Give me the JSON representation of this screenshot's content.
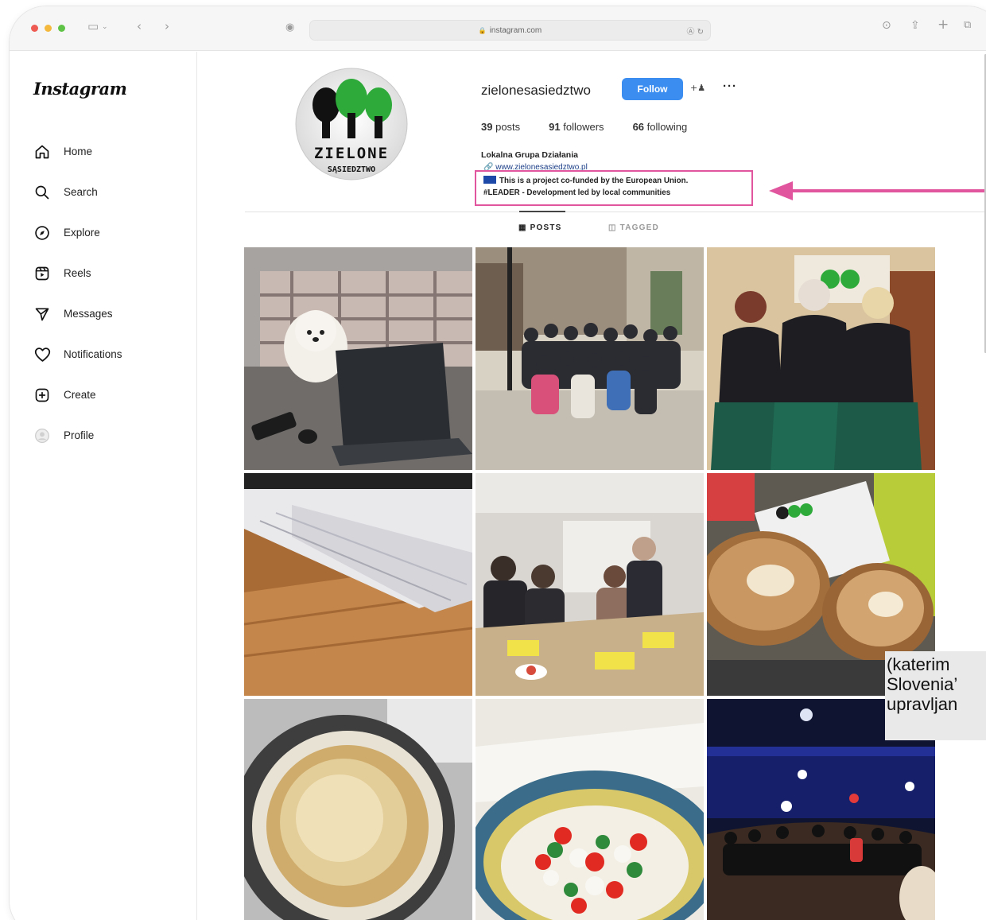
{
  "browser": {
    "url": "instagram.com",
    "url_right": "Ⓐ ↻"
  },
  "sidebar": {
    "logo": "Instagram",
    "items": [
      {
        "label": "Home",
        "icon": "home-icon"
      },
      {
        "label": "Search",
        "icon": "search-icon"
      },
      {
        "label": "Explore",
        "icon": "compass-icon"
      },
      {
        "label": "Reels",
        "icon": "reels-icon"
      },
      {
        "label": "Messages",
        "icon": "messages-icon"
      },
      {
        "label": "Notifications",
        "icon": "heart-icon"
      },
      {
        "label": "Create",
        "icon": "plus-square-icon"
      },
      {
        "label": "Profile",
        "icon": "profile-avatar-icon"
      }
    ]
  },
  "profile": {
    "avatar_text": "ZIELONE",
    "avatar_subtext": "SĄSIEDZTWO",
    "username": "zielonesasiedztwo",
    "follow_label": "Follow",
    "posts_count": "39",
    "posts_label": "posts",
    "followers_count": "91",
    "followers_label": "followers",
    "following_count": "66",
    "following_label": "following",
    "bio_name": "Lokalna Grupa Działania",
    "bio_link": "www.zielonesasiedztwo.pl",
    "bio_line1": "This is a project co-funded by the European Union.",
    "bio_line2": "#LEADER - Development led by local communities"
  },
  "tabs": {
    "posts": "POSTS",
    "tagged": "TAGGED"
  },
  "colors": {
    "follow_blue": "#3b8ef0",
    "highlight_pink": "#e0559e"
  },
  "overlay_caption": {
    "line1": "(katerim",
    "line2": "Slovenia’",
    "line3": "upravljan"
  }
}
